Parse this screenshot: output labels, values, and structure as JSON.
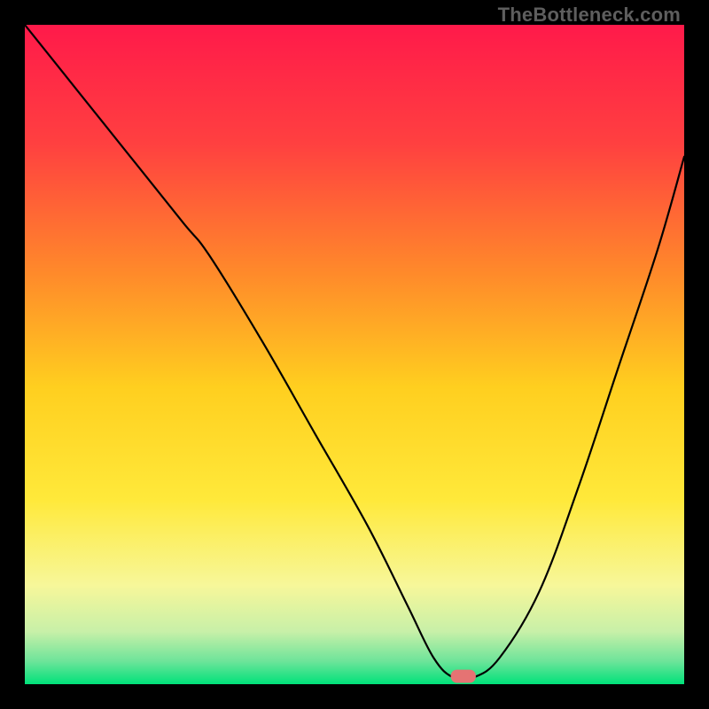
{
  "watermark": "TheBottleneck.com",
  "chart_data": {
    "type": "line",
    "title": "",
    "xlabel": "",
    "ylabel": "",
    "xlim": [
      0,
      100
    ],
    "ylim": [
      0,
      100
    ],
    "grid": false,
    "legend": false,
    "background_gradient": {
      "stops": [
        {
          "pos": 0.0,
          "color": "#ff1a4a"
        },
        {
          "pos": 0.18,
          "color": "#ff4040"
        },
        {
          "pos": 0.38,
          "color": "#ff8b2a"
        },
        {
          "pos": 0.55,
          "color": "#ffcf1f"
        },
        {
          "pos": 0.72,
          "color": "#ffe93a"
        },
        {
          "pos": 0.85,
          "color": "#f7f79a"
        },
        {
          "pos": 0.92,
          "color": "#c8f0a8"
        },
        {
          "pos": 0.965,
          "color": "#6ee49a"
        },
        {
          "pos": 1.0,
          "color": "#00e17a"
        }
      ]
    },
    "series": [
      {
        "name": "bottleneck-curve",
        "x": [
          0,
          8,
          16,
          24,
          28,
          36,
          44,
          52,
          58,
          62,
          65,
          68,
          72,
          78,
          84,
          90,
          96,
          100
        ],
        "y": [
          100,
          90,
          80,
          70,
          65,
          52,
          38,
          24,
          12,
          4,
          1,
          1,
          4,
          14,
          30,
          48,
          66,
          80
        ]
      }
    ],
    "marker": {
      "name": "optimum-marker",
      "x": 66.5,
      "y": 1.2,
      "color": "#e57373",
      "width": 3.8,
      "height": 2.0
    }
  }
}
